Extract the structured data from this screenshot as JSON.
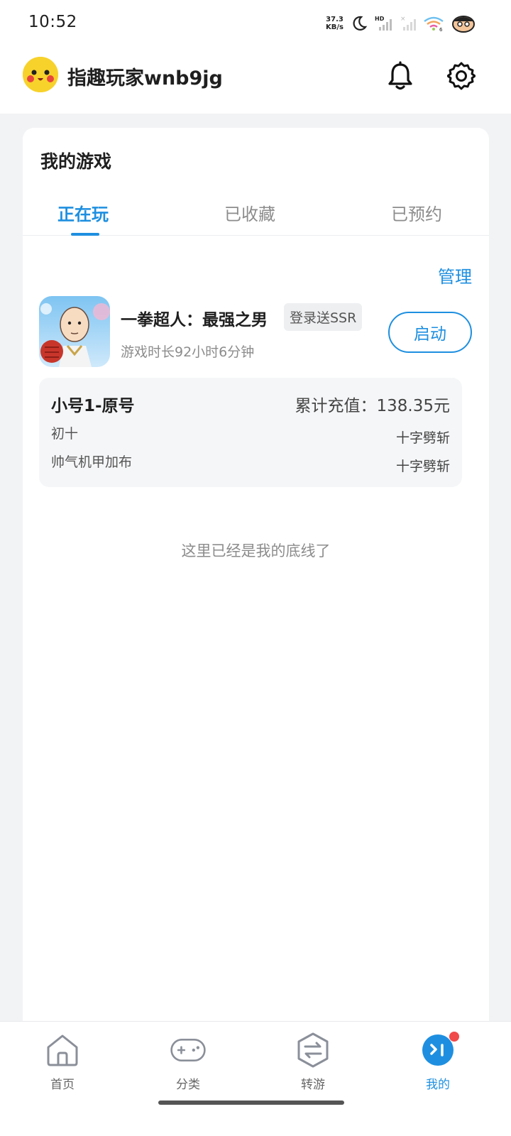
{
  "status_bar": {
    "time": "10:52",
    "net_speed_value": "37.3",
    "net_speed_unit": "KB/s",
    "icons": [
      "moon-icon",
      "hd-signal-icon",
      "signal-icon",
      "wifi-icon",
      "avatar-badge-icon"
    ]
  },
  "header": {
    "username": "指趣玩家wnb9jg",
    "avatar_icon": "pikachu-avatar",
    "bell_icon": "bell-icon",
    "settings_icon": "gear-icon"
  },
  "card": {
    "title": "我的游戏",
    "tabs": [
      {
        "label": "正在玩",
        "active": true
      },
      {
        "label": "已收藏",
        "active": false
      },
      {
        "label": "已预约",
        "active": false
      }
    ],
    "manage_label": "管理",
    "game": {
      "name": "一拳超人：最强之男",
      "tag": "登录送SSR",
      "playtime": "游戏时长92小时6分钟",
      "launch_label": "启动"
    },
    "account": {
      "name": "小号1-原号",
      "recharge": "累计充值：138.35元",
      "roles": [
        {
          "name": "初十",
          "server": "十字劈斩"
        },
        {
          "name": "帅气机甲加布",
          "server": "十字劈斩"
        }
      ]
    },
    "end_text": "这里已经是我的底线了"
  },
  "tabbar": {
    "items": [
      {
        "label": "首页",
        "icon": "home-icon",
        "active": false
      },
      {
        "label": "分类",
        "icon": "gamepad-icon",
        "active": false
      },
      {
        "label": "转游",
        "icon": "transfer-icon",
        "active": false
      },
      {
        "label": "我的",
        "icon": "profile-icon",
        "active": true,
        "badge": true
      }
    ]
  },
  "colors": {
    "accent": "#1e8fe0",
    "badge": "#f04a4a",
    "page_bg": "#f2f3f5"
  }
}
